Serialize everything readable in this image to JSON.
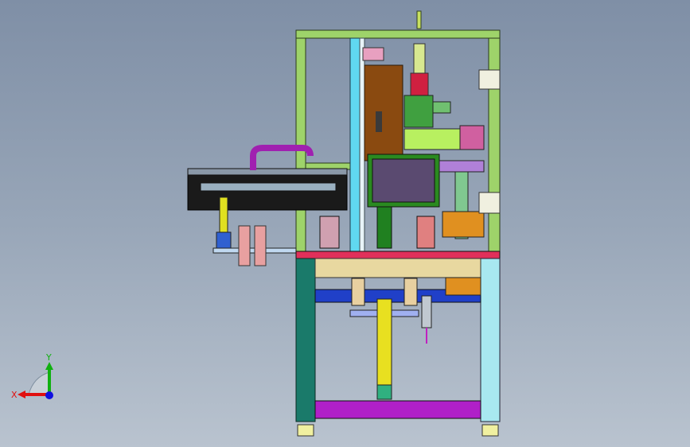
{
  "viewport": {
    "background_top": "#7f8fa6",
    "background_bottom": "#b9c3cf"
  },
  "triad": {
    "x_label": "X",
    "y_label": "Y",
    "x_color": "#e01010",
    "y_color": "#10b010",
    "z_color": "#1010e0"
  },
  "model": {
    "description_icon": "3d-machine-assembly",
    "colors": {
      "frame": "#9ed36a",
      "base_plate": "#e0305a",
      "left_leg": "#1a7a6a",
      "right_leg": "#a8e8f0",
      "bottom_bar": "#b020c8",
      "mid_bar": "#2040c8",
      "brown_plate": "#8a4a10",
      "monitor_frame": "#2a8a20",
      "monitor_screen": "#5a4a70",
      "cyan_column": "#60d8f0",
      "conveyor": "#1a1a1a",
      "cylinder": "#e0e020",
      "rollers": "#e8a0a0",
      "orange_block": "#e09020",
      "purple_tube": "#a020b0"
    }
  }
}
